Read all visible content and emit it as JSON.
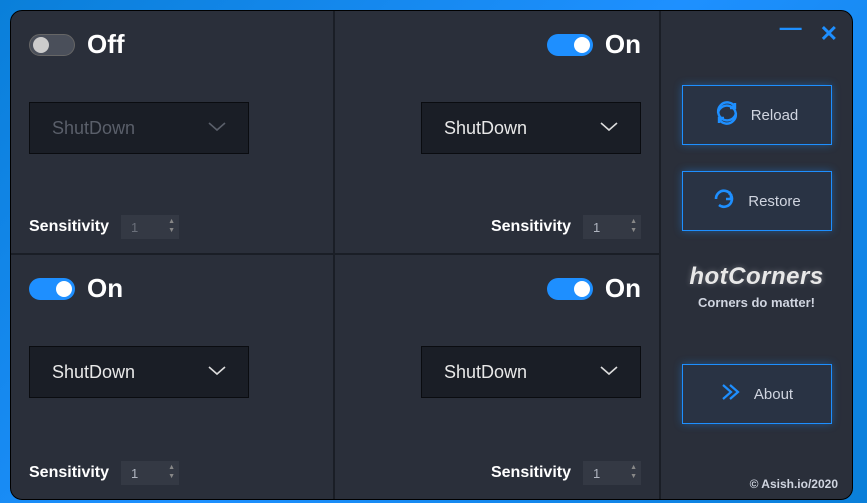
{
  "corners": {
    "top_left": {
      "enabled": false,
      "toggle_label": "Off",
      "action": "ShutDown",
      "sensitivity_label": "Sensitivity",
      "sensitivity": "1"
    },
    "top_right": {
      "enabled": true,
      "toggle_label": "On",
      "action": "ShutDown",
      "sensitivity_label": "Sensitivity",
      "sensitivity": "1"
    },
    "bottom_left": {
      "enabled": true,
      "toggle_label": "On",
      "action": "ShutDown",
      "sensitivity_label": "Sensitivity",
      "sensitivity": "1"
    },
    "bottom_right": {
      "enabled": true,
      "toggle_label": "On",
      "action": "ShutDown",
      "sensitivity_label": "Sensitivity",
      "sensitivity": "1"
    }
  },
  "sidebar": {
    "reload_label": "Reload",
    "restore_label": "Restore",
    "about_label": "About",
    "brand": "hotCorners",
    "tagline": "Corners do matter!",
    "copyright": "© Asish.io/2020"
  },
  "colors": {
    "accent": "#1e8fff",
    "panel": "#2a2f3a",
    "dark": "#1a1e26"
  }
}
